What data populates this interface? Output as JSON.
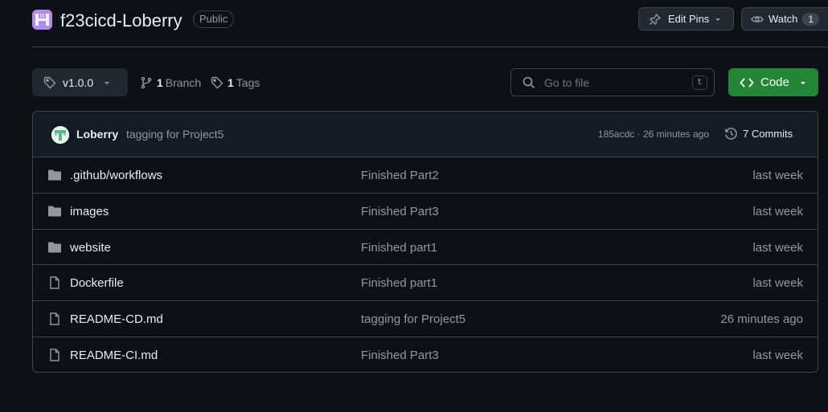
{
  "repo": {
    "name": "f23cicd-Loberry",
    "visibility": "Public"
  },
  "header": {
    "edit_pins_label": "Edit Pins",
    "watch_label": "Watch",
    "watch_count": "1"
  },
  "toolbar": {
    "branch": "v1.0.0",
    "branches_count": "1",
    "branches_label": "Branch",
    "tags_count": "1",
    "tags_label": "Tags",
    "search_placeholder": "Go to file",
    "search_shortcut": "t",
    "code_label": "Code"
  },
  "commit": {
    "author": "Loberry",
    "message": "tagging for Project5",
    "hash_time": "185acdc · 26 minutes ago",
    "commits_label": "7 Commits"
  },
  "files": [
    {
      "type": "folder",
      "name": ".github/workflows",
      "message": "Finished Part2",
      "date": "last week"
    },
    {
      "type": "folder",
      "name": "images",
      "message": "Finished Part3",
      "date": "last week"
    },
    {
      "type": "folder",
      "name": "website",
      "message": "Finished part1",
      "date": "last week"
    },
    {
      "type": "file",
      "name": "Dockerfile",
      "message": "Finished part1",
      "date": "last week"
    },
    {
      "type": "file",
      "name": "README-CD.md",
      "message": "tagging for Project5",
      "date": "26 minutes ago"
    },
    {
      "type": "file",
      "name": "README-CI.md",
      "message": "Finished Part3",
      "date": "last week"
    }
  ],
  "colors": {
    "background": "#0d1117",
    "accent_green": "#238636",
    "avatar_purple": "#b18ce8"
  }
}
